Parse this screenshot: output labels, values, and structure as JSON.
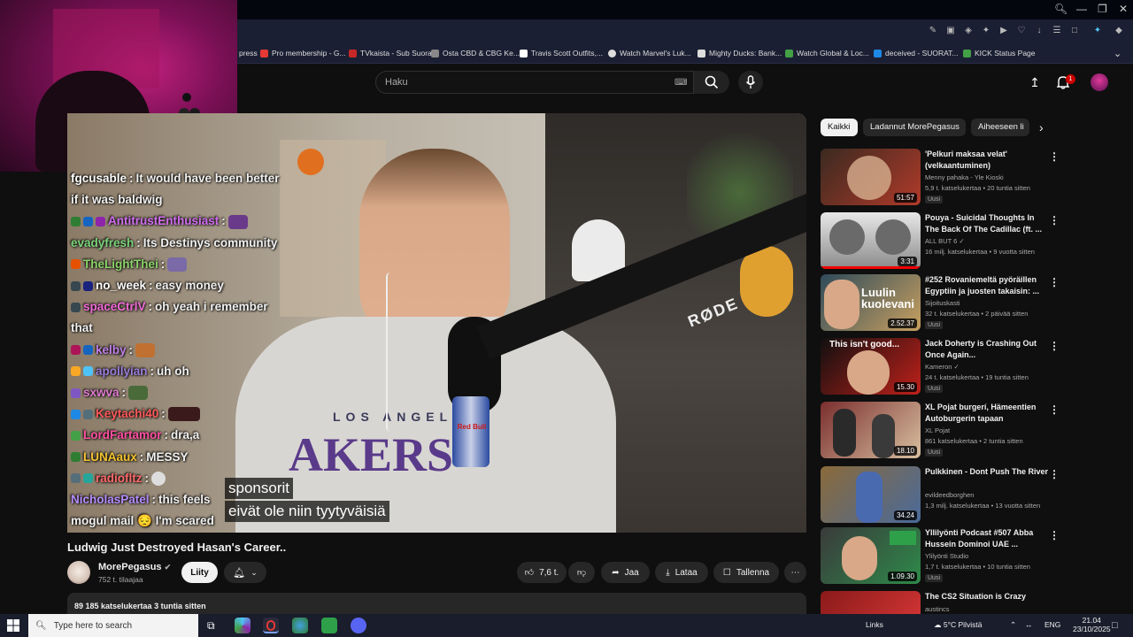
{
  "colors": {
    "yt_bg": "#0f0f0f",
    "chip_bg": "#272727",
    "notif_red": "#cc0000",
    "taskbar": "#1a1d2c"
  },
  "bookmarks": [
    {
      "label": "Pro membership - G...",
      "color": "#e53935"
    },
    {
      "label": "TVkaista - Sub Suora",
      "color": "#c62828"
    },
    {
      "label": "Osta CBD & CBG Ke...",
      "color": "#888888"
    },
    {
      "label": "Travis Scott Outfits,...",
      "color": "#ffffff"
    },
    {
      "label": "Watch Marvel's Luk...",
      "color": "#dddddd"
    },
    {
      "label": "Mighty Ducks: Bank...",
      "color": "#dddddd"
    },
    {
      "label": "Watch Global & Loc...",
      "color": "#43a047"
    },
    {
      "label": "deceived - SUORAT...",
      "color": "#1e88e5"
    },
    {
      "label": "KICK Status Page",
      "color": "#43a047"
    }
  ],
  "bookmark_prefix": "press",
  "search": {
    "placeholder": "Haku"
  },
  "notifications": {
    "count": "1"
  },
  "chat": [
    {
      "user": "fgcusable",
      "color": "#ffffff",
      "text": "It would have been better",
      "badges": []
    },
    {
      "user": "",
      "color": "#ffffff",
      "text": "if it was baldwig",
      "badges": []
    },
    {
      "user": "AntitrustEnthusiast",
      "color": "#d06cf0",
      "text": "",
      "badges": [
        "#2e7d32",
        "#1565c0",
        "#8e24aa"
      ]
    },
    {
      "user": "evadyfresh",
      "color": "#7bd47b",
      "text": "Its Destinys community",
      "badges": []
    },
    {
      "user": "TheLightThei",
      "color": "#8bd36a",
      "text": "",
      "badges": [
        "#e65100"
      ]
    },
    {
      "user": "no_week",
      "color": "#ffffff",
      "text": "easy money",
      "badges": [
        "#37474f",
        "#1a237e"
      ]
    },
    {
      "user": "spaceCtrlV",
      "color": "#f06bd8",
      "text": "oh yeah i remember",
      "badges": [
        "#37474f"
      ]
    },
    {
      "user": "",
      "color": "#ffffff",
      "text": "that",
      "badges": []
    },
    {
      "user": "kelby",
      "color": "#c080e8",
      "text": "",
      "badges": [
        "#ad1457",
        "#1565c0"
      ]
    },
    {
      "user": "apollyian",
      "color": "#9b7ddb",
      "text": "uh oh",
      "badges": [
        "#f9a825",
        "#4fc3f7"
      ]
    },
    {
      "user": "sxwva",
      "color": "#e07cd0",
      "text": "",
      "badges": [
        "#7e57c2"
      ]
    },
    {
      "user": "Keytachi40",
      "color": "#ff5a5a",
      "text": "",
      "badges": [
        "#1e88e5",
        "#546e7a"
      ]
    },
    {
      "user": "LordFartamor",
      "color": "#ff4fa0",
      "text": "dra,a",
      "badges": [
        "#43a047"
      ]
    },
    {
      "user": "LUNAaux",
      "color": "#f4c430",
      "text": "MESSY",
      "badges": [
        "#2e7d32"
      ]
    },
    {
      "user": "radiofltz",
      "color": "#ff6a6a",
      "text": "",
      "badges": [
        "#546e7a",
        "#26a69a"
      ]
    },
    {
      "user": "NicholasPatel",
      "color": "#b48cff",
      "text": "this feels",
      "badges": []
    },
    {
      "user": "",
      "color": "#ffffff",
      "text": "mogul mail 😔 I'm scared",
      "badges": []
    }
  ],
  "subtitles": [
    "sponsorit",
    "eivät ole niin tyytyväisiä"
  ],
  "video": {
    "title": "Ludwig Just Destroyed Hasan's Career..",
    "channel": "MorePegasus",
    "subscribers": "752 t. tilaajaa",
    "join_label": "Liity",
    "likes": "7,6 t.",
    "share_label": "Jaa",
    "download_label": "Lataa",
    "save_label": "Tallenna",
    "views_line": "89 185 katselukertaa  3 tuntia sitten"
  },
  "chips": [
    "Kaikki",
    "Ladannut MorePegasus",
    "Aiheeseen li"
  ],
  "recommendations": [
    {
      "title": "'Pelkuri maksaa velat' (velkaantuminen)",
      "channel": "Menny pahaka - Yle Kioski",
      "meta": "5,9 t. katselukertaa • 20 tuntia sitten",
      "new": "Uusi",
      "duration": "51:57",
      "thumb": [
        "#3a2a20",
        "#b03a2a"
      ]
    },
    {
      "title": "Pouya - Suicidal Thoughts In The Back Of The Cadillac (ft. ...",
      "channel": "ALL BUT 6 ✓",
      "meta": "16 milj. katselukertaa • 9 vuotta sitten",
      "new": "",
      "duration": "3:31",
      "thumb": [
        "#d8d8d8",
        "#6a6a6a"
      ]
    },
    {
      "title": "#252 Rovaniemeltä pyöräillen Egyptiin ja juosten takaisin: ...",
      "channel": "Sijoituskasti",
      "meta": "32 t. katselukertaa • 2 päivää sitten",
      "new": "Uusi",
      "duration": "2.52.37",
      "thumb": [
        "#2e4a5a",
        "#c8a060"
      ]
    },
    {
      "title": "Jack Doherty is Crashing Out Once Again...",
      "channel": "Kameron ✓",
      "meta": "24 t. katselukertaa • 19 tuntia sitten",
      "new": "Uusi",
      "duration": "15.30",
      "thumb": [
        "#101010",
        "#c0201a"
      ]
    },
    {
      "title": "XL Pojat burgerí, Hämeentien Autoburgerin tapaan",
      "channel": "XL Pojat",
      "meta": "861 katselukertaa • 2 tuntia sitten",
      "new": "Uusi",
      "duration": "18.10",
      "thumb": [
        "#7a2e2e",
        "#d8c0a0"
      ]
    },
    {
      "title": "Pulkkinen - Dont Push The River",
      "channel": "evildeedborghen",
      "meta": "1,3 milj. katselukertaa • 13 vuotta sitten",
      "new": "",
      "duration": "34.24",
      "thumb": [
        "#8a6a3a",
        "#4a6a9a"
      ]
    },
    {
      "title": "Yllilyönti Podcast #507 Abba Hussein Dominoi UAE ...",
      "channel": "Ylilyönti Studio",
      "meta": "1,7 t. katselukertaa • 10 tuntia sitten",
      "new": "Uusi",
      "duration": "1.09.30",
      "thumb": [
        "#3a3a3a",
        "#2e8a4a"
      ]
    },
    {
      "title": "The CS2 Situation is Crazy",
      "channel": "austincs",
      "meta": "",
      "new": "",
      "duration": "",
      "thumb": [
        "#8a1a1a",
        "#e03a3a"
      ]
    }
  ],
  "thumb_overlays": {
    "rec3": "Luulin kuolevani",
    "rec4": "This isn't good..."
  },
  "taskbar": {
    "search_placeholder": "Type here to search",
    "links_label": "Links",
    "weather": "5°C  Pilvistä",
    "lang": "ENG",
    "time": "21.04",
    "date": "23/10/2025"
  },
  "player_branding": {
    "mic_brand": "RØDE",
    "shirt": "LOS ANGELES",
    "shirt2": "AKERS",
    "can": "Red Bull"
  }
}
